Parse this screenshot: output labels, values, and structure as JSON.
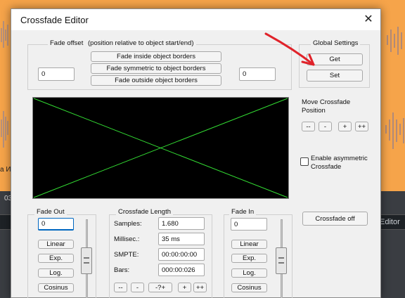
{
  "background": {
    "counter_text": "03",
    "left_label": "a Иг",
    "right_label": "Editor"
  },
  "dialog": {
    "title": "Crossfade Editor",
    "close_symbol": "✕",
    "fade_offset": {
      "label": "Fade offset",
      "hint": "(position relative to object start/end)",
      "left_value": "0",
      "right_value": "0",
      "buttons": [
        "Fade inside object borders",
        "Fade symmetric to object borders",
        "Fade outside object borders"
      ]
    },
    "global_settings": {
      "label": "Global Settings",
      "get_label": "Get",
      "set_label": "Set"
    },
    "move_crossfade": {
      "label": "Move Crossfade Position",
      "buttons": [
        "--",
        "-",
        "+",
        "++"
      ]
    },
    "asymmetric": {
      "label": "Enable asymmetric Crossfade",
      "checked": false
    },
    "fade_out": {
      "label": "Fade Out",
      "value": "0",
      "buttons": [
        "Linear",
        "Exp.",
        "Log.",
        "Cosinus"
      ]
    },
    "crossfade_length": {
      "label": "Crossfade Length",
      "rows": [
        {
          "label": "Samples:",
          "value": "1.680"
        },
        {
          "label": "Millisec.:",
          "value": "35 ms"
        },
        {
          "label": "SMPTE:",
          "value": "00:00:00:00"
        },
        {
          "label": "Bars:",
          "value": "000:00:026"
        }
      ],
      "buttons": [
        "--",
        "-",
        "-?+",
        "+",
        "++"
      ]
    },
    "fade_in": {
      "label": "Fade In",
      "value": "0",
      "buttons": [
        "Linear",
        "Exp.",
        "Log.",
        "Cosinus"
      ]
    },
    "crossfade_off_label": "Crossfade off"
  },
  "colors": {
    "background_orange": "#f6a44a",
    "curve_green": "#33dd33",
    "annotation_arrow": "#e0232a"
  }
}
